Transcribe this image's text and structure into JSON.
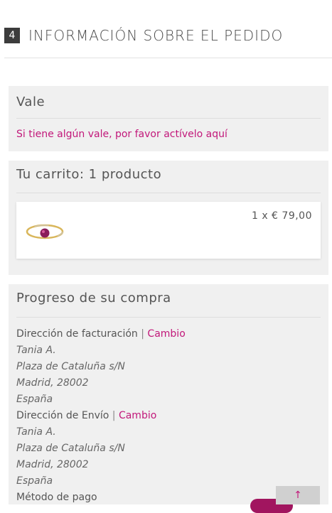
{
  "step": {
    "number": "4",
    "title": "INFORMACIÓN SOBRE EL PEDIDO"
  },
  "voucher": {
    "title": "Vale",
    "link": "Si tiene algún vale, por favor actívelo aquí"
  },
  "cart": {
    "title": "Tu carrito: 1 producto",
    "items": [
      {
        "image": "ring-with-purple-gem",
        "quantity_price": "1 x € 79,00"
      }
    ]
  },
  "progress": {
    "title": "Progreso de su compra",
    "billing": {
      "label": "Dirección de facturación",
      "separator": "|",
      "change": "Cambio",
      "lines": [
        "Tania A.",
        "Plaza de Cataluña s/N",
        "Madrid, 28002",
        "España"
      ]
    },
    "shipping": {
      "label": "Dirección de Envío",
      "separator": "|",
      "change": "Cambio",
      "lines": [
        "Tania A.",
        "Plaza de Cataluña s/N",
        "Madrid, 28002",
        "España"
      ]
    },
    "payment": {
      "label": "Método de pago"
    }
  },
  "scroll_top": {
    "icon": "arrow-up-icon",
    "glyph": "↑"
  },
  "colors": {
    "accent": "#c2187a",
    "panel_bg": "#f0f0f0",
    "step_badge": "#3c3c3c"
  }
}
